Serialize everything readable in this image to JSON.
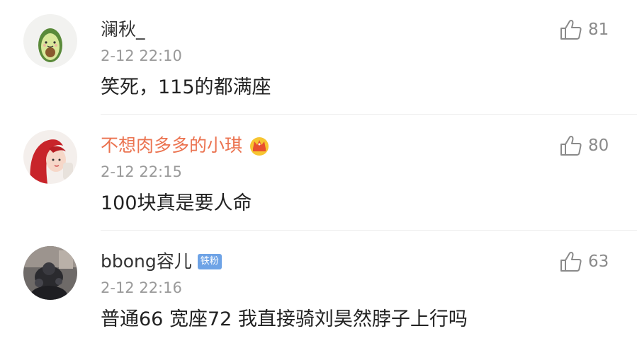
{
  "comments": [
    {
      "username": "澜秋_",
      "time": "2-12 22:10",
      "text": "笑死，115的都满座",
      "likes": "81",
      "avatar_icon": "avocado-avatar",
      "vip": false
    },
    {
      "username": "不想肉多多的小琪",
      "time": "2-12 22:15",
      "text": "100块真是要人命",
      "likes": "80",
      "avatar_icon": "red-hair-avatar",
      "vip": true,
      "badge_icon": "crown-icon"
    },
    {
      "username": "bbong容儿",
      "time": "2-12 22:16",
      "text": "普通66 宽座72 我直接骑刘昊然脖子上行吗",
      "likes": "63",
      "avatar_icon": "photo-avatar",
      "vip": false,
      "badge": "铁粉"
    }
  ],
  "colors": {
    "vip_name": "#eb7350",
    "fan_badge": "#6ea3e6",
    "time": "#9a9a9a",
    "like": "#8a8a8a"
  }
}
